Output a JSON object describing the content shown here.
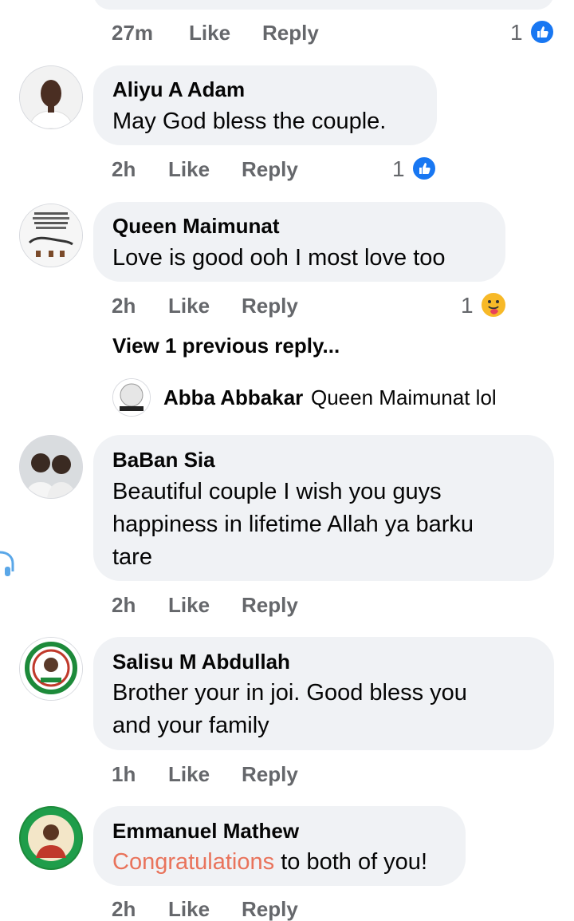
{
  "top_meta": {
    "time": "27m",
    "like": "Like",
    "reply": "Reply",
    "reaction_count": "1"
  },
  "comments": [
    {
      "author": "Aliyu A Adam",
      "text": "May God bless the couple.",
      "time": "2h",
      "like": "Like",
      "reply": "Reply",
      "reaction_count": "1",
      "reaction": "like-icon"
    },
    {
      "author": "Queen Maimunat",
      "text": "Love is good ooh I most love too",
      "time": "2h",
      "like": "Like",
      "reply": "Reply",
      "reaction_count": "1",
      "reaction": "care-icon",
      "view_replies": "View 1 previous reply...",
      "reply_preview": {
        "author": "Abba Abbakar",
        "text": "Queen Maimunat lol"
      }
    },
    {
      "author": "BaBan Sia",
      "text_lines": [
        "Beautiful couple I wish you guys",
        "happiness in lifetime Allah ya barku",
        "tare"
      ],
      "time": "2h",
      "like": "Like",
      "reply": "Reply"
    },
    {
      "author": "Salisu M Abdullah",
      "text_lines": [
        "Brother your in joi. Good bless you",
        "and your family"
      ],
      "time": "1h",
      "like": "Like",
      "reply": "Reply"
    },
    {
      "author": "Emmanuel Mathew",
      "text_link": "Congratulations",
      "text_rest": " to both of you!",
      "time": "2h",
      "like": "Like",
      "reply": "Reply"
    }
  ],
  "colors": {
    "bubble": "#f0f2f5",
    "meta": "#65676b",
    "like_blue": "#1877f2",
    "link": "#e9735b"
  }
}
